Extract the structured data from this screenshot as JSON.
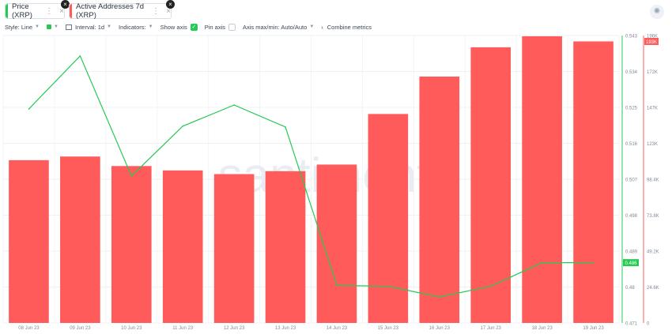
{
  "tabs": [
    {
      "label": "Price (XRP)",
      "color": "#26c953"
    },
    {
      "label": "Active Addresses 7d (XRP)",
      "color": "#ff5b5b"
    }
  ],
  "icons": {
    "settings": "gear-icon",
    "more": "⋮",
    "close": "×"
  },
  "toolbar": {
    "style": "Style: Line",
    "interval": "Interval: 1d",
    "indicators": "Indicators:",
    "show_axis": "Show axis",
    "pin_axis": "Pin axis",
    "axis_maxmin": "Axis max/min: Auto/Auto",
    "combine": "Combine metrics",
    "combine_arrow": "›"
  },
  "watermark": "santiment",
  "chart_data": {
    "type": "bar",
    "categories": [
      "08 Jun 23",
      "09 Jun 23",
      "10 Jun 23",
      "11 Jun 23",
      "12 Jun 23",
      "13 Jun 23",
      "14 Jun 23",
      "15 Jun 23",
      "16 Jun 23",
      "17 Jun 23",
      "18 Jun 23",
      "19 Jun 23"
    ],
    "series": [
      {
        "name": "Active Addresses 7d (XRP)",
        "type": "bar",
        "axis": "right",
        "color": "#ff5b5b",
        "values": [
          111000,
          113500,
          107000,
          104000,
          101500,
          103500,
          108000,
          142500,
          168000,
          188000,
          195500,
          192000
        ]
      },
      {
        "name": "Price (XRP)",
        "type": "line",
        "axis": "left",
        "color": "#26c953",
        "values": [
          0.5246,
          0.5379,
          0.5078,
          0.5203,
          0.5256,
          0.5201,
          0.4804,
          0.4802,
          0.4775,
          0.4802,
          0.4861,
          0.4861
        ]
      }
    ],
    "left_axis": {
      "ticks": [
        "0.543",
        "0.534",
        "0.525",
        "0.516",
        "0.507",
        "0.498",
        "0.489",
        "0.48",
        "0.471"
      ],
      "range": [
        0.471,
        0.543
      ],
      "current": "0.486",
      "color": "#26c953"
    },
    "right_axis": {
      "ticks": [
        "196K",
        "172K",
        "147K",
        "123K",
        "98.4K",
        "73.8K",
        "49.2K",
        "24.6K",
        "0"
      ],
      "range": [
        0,
        196000
      ],
      "current": "193K",
      "color": "#ff5b5b"
    },
    "grid": true
  }
}
